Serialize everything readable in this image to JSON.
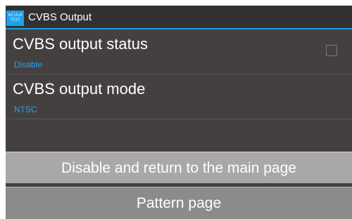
{
  "window": {
    "title": "CVBS Output",
    "icon_lines": [
      "ACULA",
      "TEST"
    ]
  },
  "settings": [
    {
      "title": "CVBS output status",
      "value": "Disable",
      "checked": false
    },
    {
      "title": "CVBS output mode",
      "value": "NTSC"
    }
  ],
  "buttons": {
    "disable_return": "Disable and return to the main page",
    "pattern_page": "Pattern page"
  },
  "colors": {
    "accent": "#1DA4F1",
    "background": "#454040",
    "titlebar": "#323030",
    "button_light": "#A8A8A8",
    "button_dark": "#8B8B8B"
  },
  "icons": {
    "app": "acula-test-app-icon",
    "checkbox": "empty-checkbox"
  }
}
